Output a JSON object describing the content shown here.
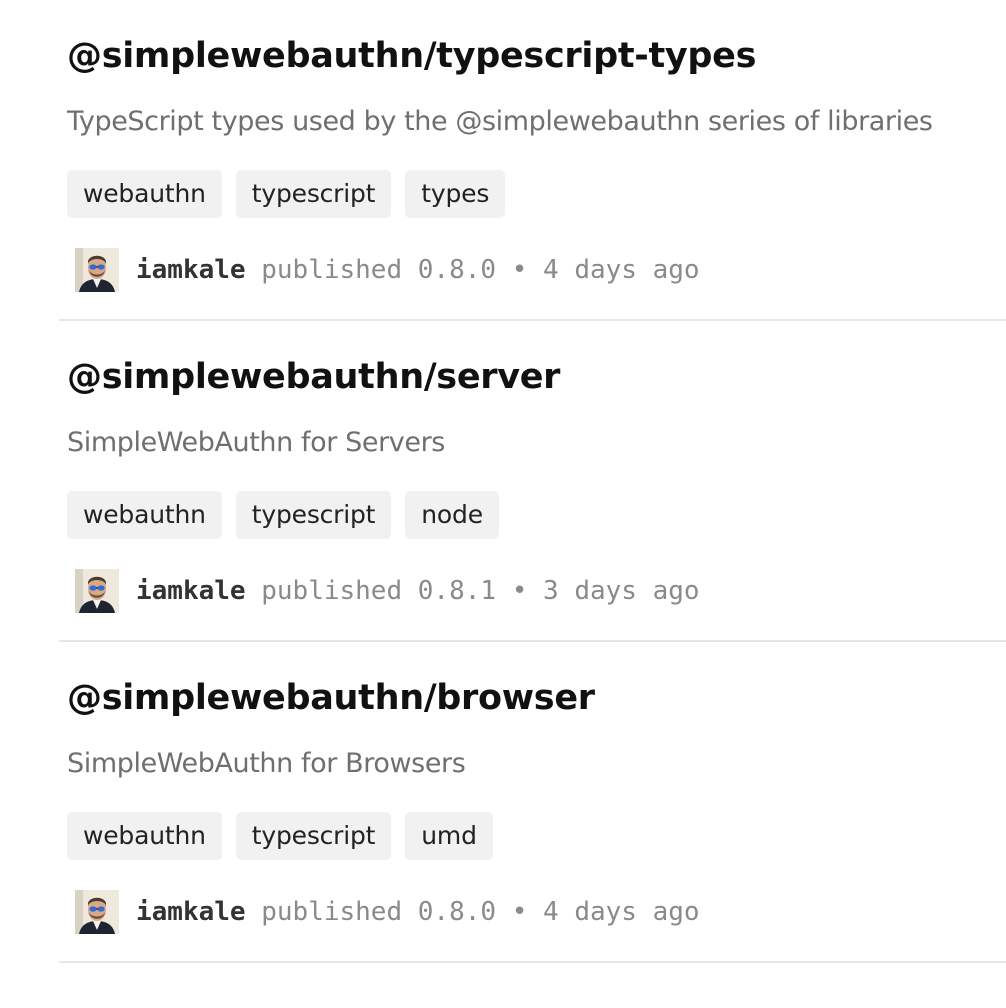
{
  "colors": {
    "title": "#111111",
    "description": "#6f6f6f",
    "tag_background": "#f1f1f1",
    "divider": "#e6e6e6"
  },
  "packages": [
    {
      "name": "@simplewebauthn/typescript-types",
      "description": "TypeScript types used by the @simplewebauthn series of libraries",
      "keywords": [
        "webauthn",
        "typescript",
        "types"
      ],
      "publisher": "iamkale",
      "published_word": "published",
      "version": "0.8.0",
      "separator": "•",
      "time_ago": "4 days ago"
    },
    {
      "name": "@simplewebauthn/server",
      "description": "SimpleWebAuthn for Servers",
      "keywords": [
        "webauthn",
        "typescript",
        "node"
      ],
      "publisher": "iamkale",
      "published_word": "published",
      "version": "0.8.1",
      "separator": "•",
      "time_ago": "3 days ago"
    },
    {
      "name": "@simplewebauthn/browser",
      "description": "SimpleWebAuthn for Browsers",
      "keywords": [
        "webauthn",
        "typescript",
        "umd"
      ],
      "publisher": "iamkale",
      "published_word": "published",
      "version": "0.8.0",
      "separator": "•",
      "time_ago": "4 days ago"
    }
  ]
}
